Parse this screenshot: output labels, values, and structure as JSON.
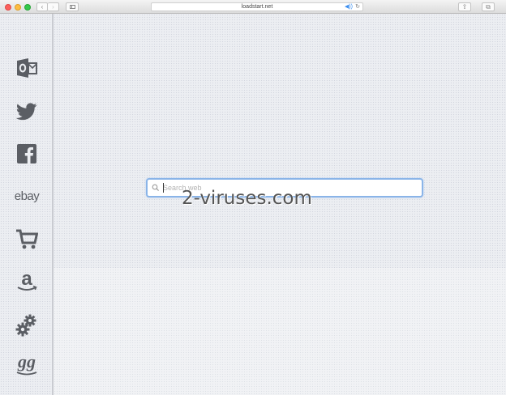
{
  "browser": {
    "url": "loadstart.net",
    "back_glyph": "‹",
    "forward_glyph": "›",
    "share_glyph": "⇪",
    "tabs_glyph": "⧉",
    "audio_glyph": "◀))",
    "reload_glyph": "↻"
  },
  "sidebar": {
    "items": [
      {
        "name": "outlook",
        "icon": "outlook-icon"
      },
      {
        "name": "twitter",
        "icon": "twitter-bird-icon"
      },
      {
        "name": "facebook",
        "icon": "facebook-icon"
      },
      {
        "name": "ebay",
        "label": "ebay"
      },
      {
        "name": "shopping-cart",
        "icon": "shopping-cart-icon"
      },
      {
        "name": "amazon",
        "icon": "amazon-icon",
        "glyph": "a"
      },
      {
        "name": "settings",
        "icon": "gears-icon"
      },
      {
        "name": "gg",
        "label": "gg"
      }
    ]
  },
  "search": {
    "placeholder": "Search web",
    "value": ""
  },
  "watermark": "2-viruses.com",
  "colors": {
    "icon": "#5b5e64",
    "search_border": "#8ab4e8",
    "accent_blue": "#3b8ef0"
  }
}
